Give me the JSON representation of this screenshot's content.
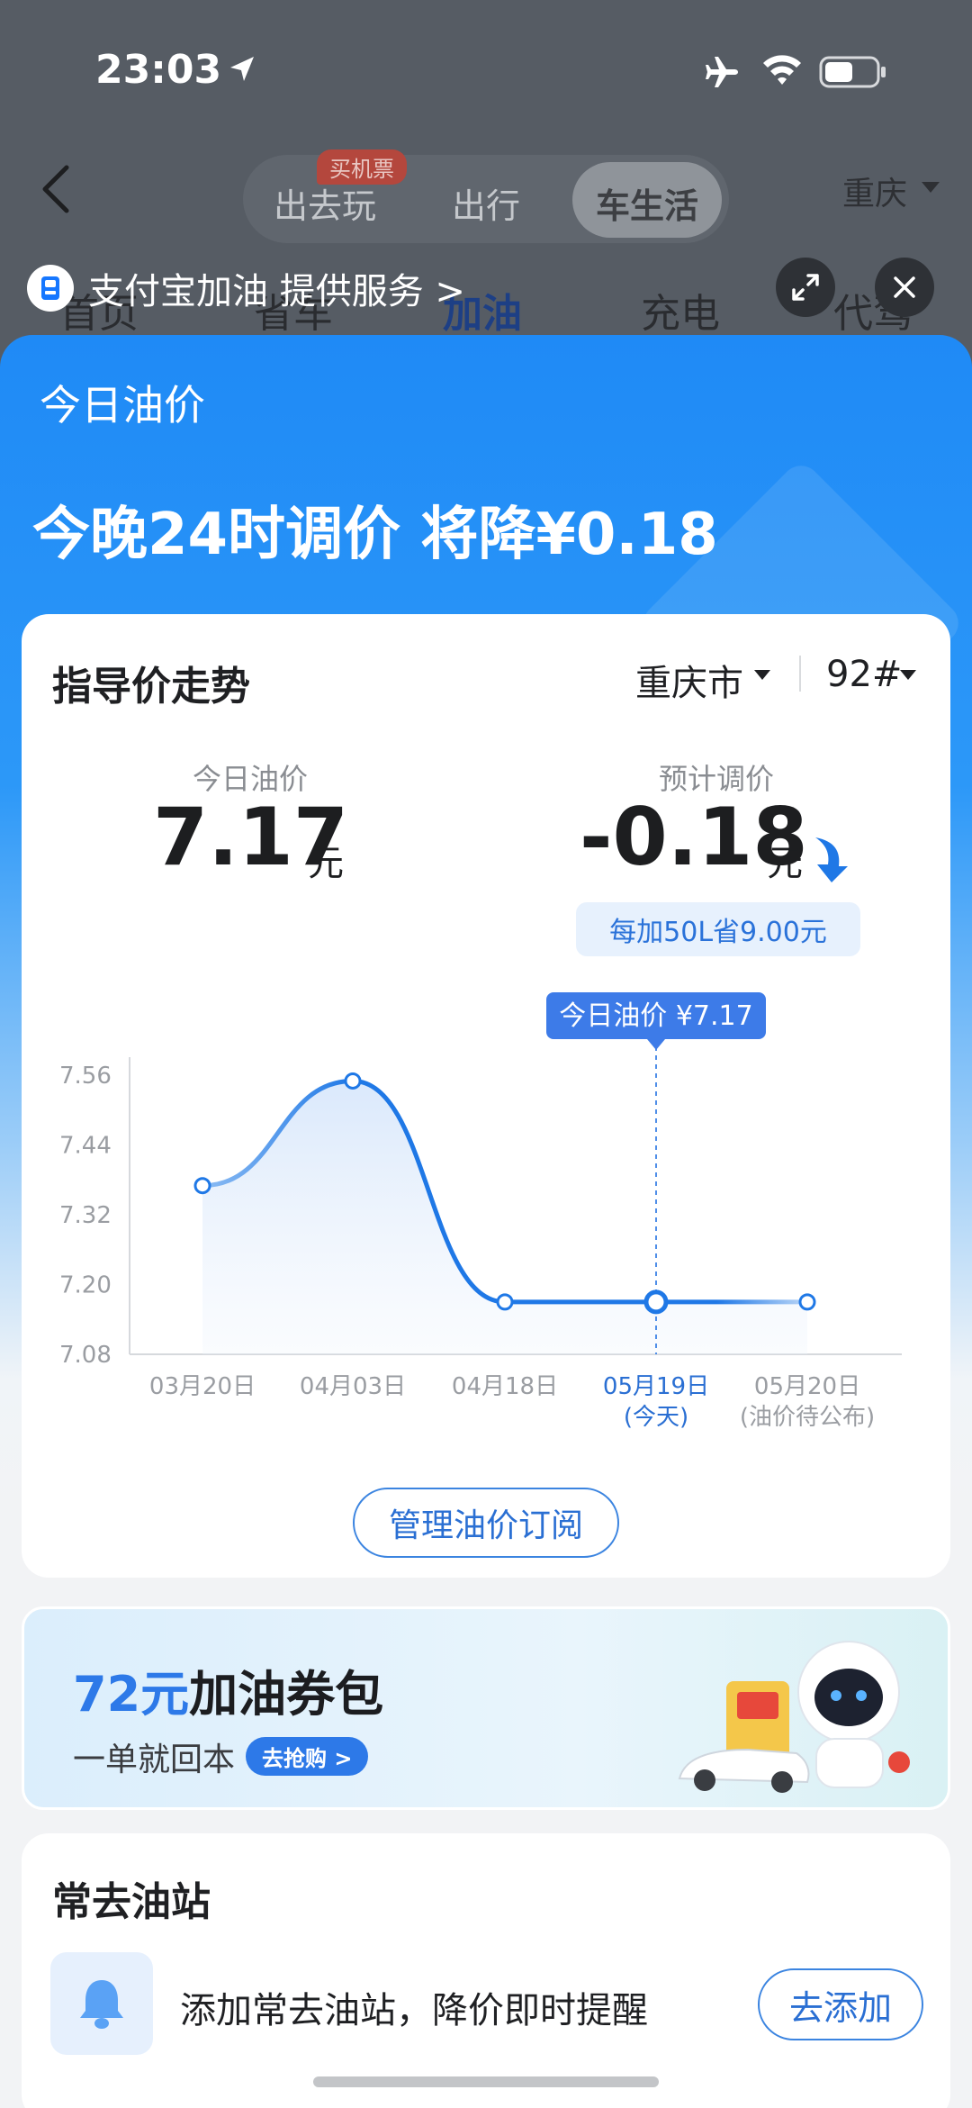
{
  "status_bar": {
    "time": "23:03"
  },
  "top_nav": {
    "tabs": [
      {
        "label": "出去玩",
        "badge": "买机票"
      },
      {
        "label": "出行"
      },
      {
        "label": "车生活",
        "active": true
      }
    ],
    "city": "重庆"
  },
  "sub_tabs": [
    "首页",
    "省车",
    "加油",
    "充电",
    "代驾"
  ],
  "provider": {
    "text": "支付宝加油 提供服务 >"
  },
  "sheet": {
    "title": "今日油价",
    "headline": "今晚24时调价 将降¥0.18"
  },
  "trend_card": {
    "title": "指导价走势",
    "city_select": "重庆市",
    "fuel_select": "92#",
    "today_label": "今日油价",
    "today_value": "7.17",
    "today_unit": "元",
    "forecast_label": "预计调价",
    "forecast_value": "-0.18",
    "forecast_unit": "元",
    "saving_chip": "每加50L省9.00元",
    "manage_button": "管理油价订阅"
  },
  "chart_data": {
    "type": "line",
    "x": [
      "03月20日",
      "04月03日",
      "04月18日",
      "05月19日",
      "05月20日"
    ],
    "x_sub": [
      "",
      "",
      "",
      "(今天)",
      "(油价待公布)"
    ],
    "series": [
      {
        "values": [
          7.37,
          7.55,
          7.17,
          7.17,
          7.17
        ]
      }
    ],
    "yticks": [
      "7.56",
      "7.44",
      "7.32",
      "7.20",
      "7.08"
    ],
    "ylim": [
      7.08,
      7.56
    ],
    "tooltip": "今日油价 ¥7.17",
    "highlight_index": 3,
    "colors": {
      "line": "#1f78e6",
      "highlight_text": "#2a6fd3",
      "tooltip_bg": "#3d7be8"
    }
  },
  "promo": {
    "amount": "72元",
    "title_rest": "加油券包",
    "subtitle": "一单就回本",
    "button": "去抢购 >"
  },
  "stations": {
    "title": "常去油站",
    "text": "添加常去油站，降价即时提醒",
    "button": "去添加"
  }
}
